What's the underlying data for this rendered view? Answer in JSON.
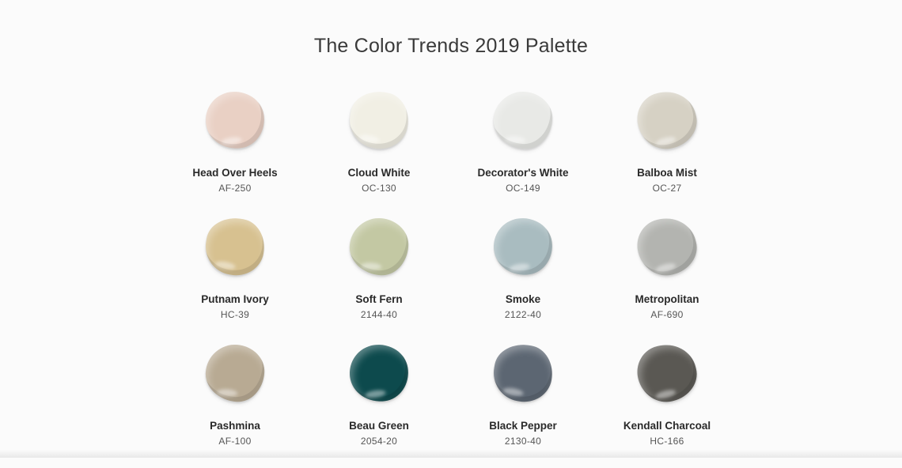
{
  "page": {
    "title": "The Color Trends 2019 Palette"
  },
  "swatches": [
    {
      "name": "Head Over Heels",
      "code": "AF-250",
      "color": "#e9d0c4"
    },
    {
      "name": "Cloud White",
      "code": "OC-130",
      "color": "#f1efe4"
    },
    {
      "name": "Decorator's White",
      "code": "OC-149",
      "color": "#e8e9e6"
    },
    {
      "name": "Balboa Mist",
      "code": "OC-27",
      "color": "#d6d1c4"
    },
    {
      "name": "Putnam Ivory",
      "code": "HC-39",
      "color": "#d7c190"
    },
    {
      "name": "Soft Fern",
      "code": "2144-40",
      "color": "#c3c8a3"
    },
    {
      "name": "Smoke",
      "code": "2122-40",
      "color": "#a9bcc0"
    },
    {
      "name": "Metropolitan",
      "code": "AF-690",
      "color": "#b3b4b0"
    },
    {
      "name": "Pashmina",
      "code": "AF-100",
      "color": "#b8aa93"
    },
    {
      "name": "Beau Green",
      "code": "2054-20",
      "color": "#0d4a4d"
    },
    {
      "name": "Black Pepper",
      "code": "2130-40",
      "color": "#5c6672"
    },
    {
      "name": "Kendall Charcoal",
      "code": "HC-166",
      "color": "#5a5853"
    }
  ]
}
